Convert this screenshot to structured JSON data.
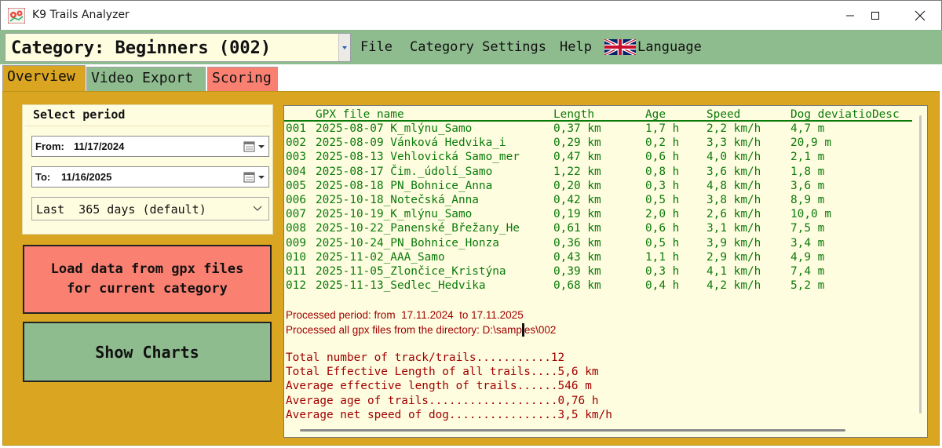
{
  "window": {
    "title": "K9  Trails Analyzer"
  },
  "category": {
    "label": "Category: Beginners (002)"
  },
  "menu": {
    "file": "File",
    "category_settings": "Category Settings",
    "help": "Help",
    "language": "Language"
  },
  "tabs": [
    {
      "label": "Overview",
      "color": "#daa520",
      "active": true
    },
    {
      "label": "Video Export",
      "color": "#8fbc8f",
      "active": false
    },
    {
      "label": "Scoring",
      "color": "#fa8072",
      "active": false
    }
  ],
  "period": {
    "title": "Select period",
    "from_label": "From:",
    "from_value": "11/17/2024",
    "to_label": "To:",
    "to_value": "11/16/2025",
    "range_selected": "Last  365 days (default)"
  },
  "buttons": {
    "load": "Load data from gpx files\nfor current category",
    "charts": "Show Charts"
  },
  "table": {
    "headers": [
      "GPX file name",
      "Length",
      "Age",
      "Speed",
      "Dog deviatioDesc"
    ],
    "rows": [
      {
        "no": "001",
        "name": "2025-08-07 K_mlýnu_Samo",
        "length": "0,37 km",
        "age": "1,7 h",
        "speed": "2,2 km/h",
        "dev": "4,7 m"
      },
      {
        "no": "002",
        "name": "2025-08-09 Vánková Hedvika_i",
        "length": "0,29 km",
        "age": "0,2 h",
        "speed": "3,3 km/h",
        "dev": "20,9 m"
      },
      {
        "no": "003",
        "name": "2025-08-13 Vehlovická Samo_mer",
        "length": "0,47 km",
        "age": "0,6 h",
        "speed": "4,0 km/h",
        "dev": "2,1 m"
      },
      {
        "no": "004",
        "name": "2025-08-17 Čim._údolí_Samo",
        "length": "1,22 km",
        "age": "0,8 h",
        "speed": "3,6 km/h",
        "dev": "1,8 m"
      },
      {
        "no": "005",
        "name": "2025-08-18 PN_Bohnice_Anna",
        "length": "0,20 km",
        "age": "0,3 h",
        "speed": "4,8 km/h",
        "dev": "3,6 m"
      },
      {
        "no": "006",
        "name": "2025-10-18_Notečská_Anna",
        "length": "0,42 km",
        "age": "0,5 h",
        "speed": "3,8 km/h",
        "dev": "8,9 m"
      },
      {
        "no": "007",
        "name": "2025-10-19_K_mlýnu_Samo",
        "length": "0,19 km",
        "age": "2,0 h",
        "speed": "2,6 km/h",
        "dev": "10,0 m"
      },
      {
        "no": "008",
        "name": "2025-10-22_Panenské_Břežany_He",
        "length": "0,61 km",
        "age": "0,6 h",
        "speed": "3,1 km/h",
        "dev": "7,5 m"
      },
      {
        "no": "009",
        "name": "2025-10-24_PN_Bohnice_Honza",
        "length": "0,36 km",
        "age": "0,5 h",
        "speed": "3,9 km/h",
        "dev": "3,4 m"
      },
      {
        "no": "010",
        "name": "2025-11-02_AAA_Samo",
        "length": "0,43 km",
        "age": "1,1 h",
        "speed": "2,9 km/h",
        "dev": "4,9 m"
      },
      {
        "no": "011",
        "name": "2025-11-05_Zlončice_Kristýna",
        "length": "0,39 km",
        "age": "0,3 h",
        "speed": "4,1 km/h",
        "dev": "7,4 m"
      },
      {
        "no": "012",
        "name": "2025-11-13_Sedlec_Hedvika",
        "length": "0,68 km",
        "age": "0,4 h",
        "speed": "4,2 km/h",
        "dev": "5,2 m"
      }
    ]
  },
  "info": {
    "processed_period": "Processed period: from  17.11.2024  to 17.11.2025",
    "processed_dir": "Processed all gpx files from the directory: D:\\samples\\002"
  },
  "summary": [
    "Total number of track/trails...........12",
    "Total Effective Length of all trails....5,6 km",
    "Average effective length of trails......546 m",
    "Average age of trails...................0,76 h",
    "Average net speed of dog................3,5 km/h"
  ],
  "colors": {
    "menu_green": "#8fbc8f",
    "gold": "#daa520",
    "salmon": "#fa8072",
    "cream": "#fffde0",
    "table_green": "#0a7a0a",
    "info_red": "#a00000"
  }
}
